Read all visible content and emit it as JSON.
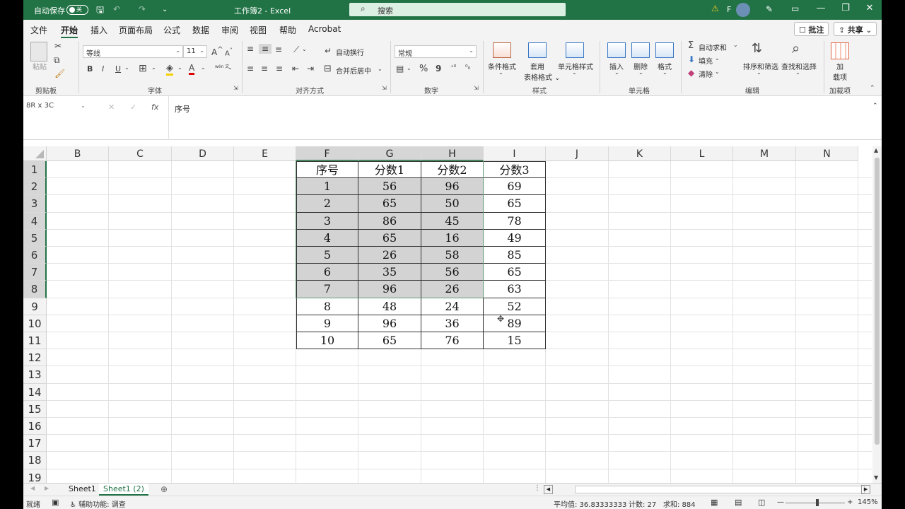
{
  "titlebar": {
    "autosave_label": "自动保存",
    "toggle_state": "关",
    "filename": "工作簿2",
    "separator": "-",
    "app": "Excel",
    "search_placeholder": "搜索",
    "user_initial": "F"
  },
  "menu": {
    "items": [
      "文件",
      "开始",
      "插入",
      "页面布局",
      "公式",
      "数据",
      "审阅",
      "视图",
      "帮助",
      "Acrobat"
    ],
    "active": "开始",
    "comment_btn": "批注",
    "share_btn": "共享"
  },
  "ribbon": {
    "clipboard": {
      "paste": "粘贴",
      "label": "剪贴板"
    },
    "font": {
      "name": "等线",
      "size": "11",
      "label": "字体",
      "bold": "B",
      "italic": "I",
      "underline": "U",
      "grow": "A",
      "shrink": "A",
      "wen": "wén 文"
    },
    "align": {
      "wrap": "自动换行",
      "merge": "合并后居中",
      "label": "对齐方式"
    },
    "number": {
      "format": "常规",
      "label": "数字",
      "percent": "%",
      "comma": "9"
    },
    "styles": {
      "cond": "条件格式",
      "table_l1": "套用",
      "table_l2": "表格格式",
      "cell": "单元格样式",
      "label": "样式"
    },
    "cells": {
      "insert": "插入",
      "delete": "删除",
      "format": "格式",
      "label": "单元格"
    },
    "editing": {
      "autosum": "自动求和",
      "fill": "填充",
      "clear": "清除",
      "sort": "排序和筛选",
      "find": "查找和选择",
      "label": "编辑"
    },
    "addins": {
      "btn_l1": "加",
      "btn_l2": "载项",
      "label": "加载项"
    }
  },
  "formula": {
    "namebox": "8R x 3C",
    "cancel": "✕",
    "enter": "✓",
    "fx": "fx",
    "value": "序号"
  },
  "columns": [
    "B",
    "C",
    "D",
    "E",
    "F",
    "G",
    "H",
    "I",
    "J",
    "K",
    "L",
    "M",
    "N"
  ],
  "rows": [
    "1",
    "2",
    "3",
    "4",
    "5",
    "6",
    "7",
    "8",
    "9",
    "10",
    "11",
    "12",
    "13",
    "14",
    "15",
    "16",
    "17",
    "18",
    "19"
  ],
  "table": {
    "headers": [
      "序号",
      "分数1",
      "分数2",
      "分数3"
    ],
    "rows": [
      [
        "1",
        "56",
        "96",
        "69"
      ],
      [
        "2",
        "65",
        "50",
        "65"
      ],
      [
        "3",
        "86",
        "45",
        "78"
      ],
      [
        "4",
        "65",
        "16",
        "49"
      ],
      [
        "5",
        "26",
        "58",
        "85"
      ],
      [
        "6",
        "35",
        "56",
        "65"
      ],
      [
        "7",
        "96",
        "26",
        "63"
      ],
      [
        "8",
        "48",
        "24",
        "52"
      ],
      [
        "9",
        "96",
        "36",
        "89"
      ],
      [
        "10",
        "65",
        "76",
        "15"
      ]
    ]
  },
  "sheets": [
    "Sheet1",
    "Sheet1 (2)"
  ],
  "active_sheet": "Sheet1 (2)",
  "status": {
    "ready": "就绪",
    "accessibility": "辅助功能: 调查",
    "average": "平均值: 36.83333333",
    "count": "计数: 27",
    "sum": "求和: 884",
    "zoom": "145%"
  },
  "colors": {
    "accent": "#217346",
    "selection": "#d3d3d3"
  }
}
